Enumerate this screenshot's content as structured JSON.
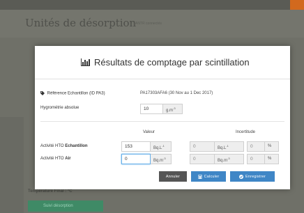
{
  "background": {
    "page_title": "Unités de désorption",
    "subtitle": "S SANTR connectés",
    "section_label": "Température Final : °C",
    "desorption_button_label": "Suivi désorption"
  },
  "modal": {
    "title": "Résultats de comptage par scintillation",
    "reference": {
      "label": "Référence Echantillon (ID PA3)",
      "value": "PA17303AFA6 (30 Nov au 1 Dec 2017)"
    },
    "hygrometry": {
      "label": "Hygrométrie absolue",
      "value": "10",
      "unit": "g.m",
      "unit_exp": "-3"
    },
    "columns": {
      "value": "Valeur",
      "uncertainty": "Incertitude"
    },
    "rows": [
      {
        "label_prefix": "Activité HTO ",
        "label_bold": "Echantillon",
        "value": "153",
        "unit": "Bq.L",
        "unit_exp": "-1",
        "unc_value": "0",
        "unc_unit": "Bq.L",
        "unc_unit_exp": "-1",
        "unc_pct": "0",
        "pct_symbol": "%"
      },
      {
        "label_prefix": "Activité HTO ",
        "label_bold": "Air",
        "value": "0",
        "unit": "Bq.m",
        "unit_exp": "-3",
        "unc_value": "0",
        "unc_unit": "Bq.m",
        "unc_unit_exp": "-3",
        "unc_pct": "0",
        "pct_symbol": "%"
      }
    ],
    "buttons": {
      "cancel": "Annuler",
      "calculate": "Calculer",
      "save": "Enregistrer"
    }
  },
  "colors": {
    "primary": "#3f86c6",
    "cancel": "#555555",
    "success": "#3f8a66"
  }
}
